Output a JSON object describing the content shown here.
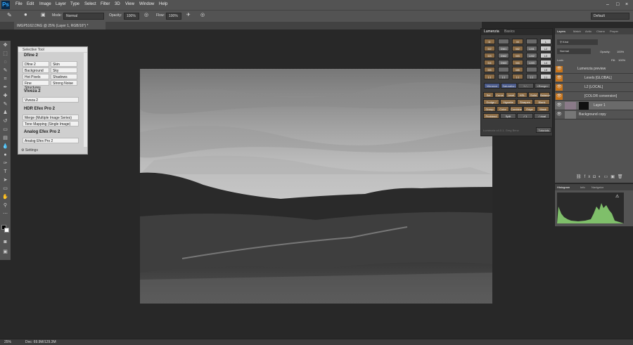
{
  "menubar": {
    "app_icon": "Ps",
    "items": [
      "File",
      "Edit",
      "Image",
      "Layer",
      "Type",
      "Select",
      "Filter",
      "3D",
      "View",
      "Window",
      "Help"
    ]
  },
  "options": {
    "mode_label": "Mode:",
    "mode_value": "Normal",
    "opacity_label": "Opacity:",
    "opacity_value": "100%",
    "flow_label": "Flow:",
    "flow_value": "100%",
    "workspace": "Default"
  },
  "document": {
    "tab_title": "IMGP5162.DNG @ 25% (Layer 1, RGB/16*) *"
  },
  "status": {
    "zoom": "25%",
    "doc": "Doc: 69.9M/129.3M"
  },
  "selective": {
    "title": "Selective Tool",
    "dfine_header": "Dfine 2",
    "dfine_cells": [
      "Dfine 2",
      "Skin",
      "Background",
      "Sky",
      "Hot Pixels",
      "Shadows",
      "Fine Structures",
      "Strong Noise"
    ],
    "viveza_header": "Viveza 2",
    "viveza_item": "Viveza 2",
    "hdr_header": "HDR Efex Pro 2",
    "hdr_items": [
      "Merge (Multiple Image Series)",
      "Tone Mapping (Single Image)"
    ],
    "analog_header": "Analog Efex Pro 2",
    "analog_item": "Analog Efex Pro 2",
    "settings": "Settings"
  },
  "lumenzia": {
    "tabs": [
      "Lumenzia",
      "Basics"
    ],
    "grid_left": [
      "D",
      "D2",
      "D3",
      "D4",
      "D5",
      "(-)"
    ],
    "grid_mid1": [
      "",
      "DM1",
      "DM2",
      "DM3",
      "",
      "(-)"
    ],
    "grid_mid2": [
      "M",
      "M2",
      "M3",
      "M4",
      "M5",
      "(-)"
    ],
    "grid_mid3": [
      "",
      "LM1",
      "LM2",
      "LM3",
      "",
      "(-)"
    ],
    "grid_right": [
      "L",
      "L2",
      "L3",
      "L4",
      "L5",
      "(-)"
    ],
    "row_wb": [
      "Vibrance",
      "Saturation",
      "+ / -",
      "<Range>"
    ],
    "buttons": [
      [
        "Sel",
        "Curve",
        "Level",
        "HSL",
        "Solid",
        "Balance"
      ],
      [
        "Dodge / Burn",
        "Vignette",
        "Sharpen",
        "Blank"
      ],
      [
        "Group",
        "Color",
        "Combine",
        "Edge",
        "Mask"
      ],
      [
        "Preblend",
        "Split",
        "✓1",
        "✓dual"
      ]
    ],
    "footer": "Lumenzia v4.0.1, Greg Benz",
    "tutorials": "Tutorials"
  },
  "layers": {
    "tabs": [
      "Layers",
      "Match",
      "Actio",
      "Chann",
      "Proper"
    ],
    "kind": "Kind",
    "blend": "Normal",
    "opacity_label": "Opacity:",
    "opacity_value": "100%",
    "lock_label": "Lock:",
    "fill_label": "Fill:",
    "fill_value": "100%",
    "items": [
      "Lumenzia preview",
      "Levels [GLOBAL]",
      "L2 [LOCAL]",
      "[COLOR conversion]",
      "Layer 1",
      "Background copy"
    ]
  },
  "histogram": {
    "tabs": [
      "Histogram",
      "Info",
      "Navigator"
    ]
  },
  "colors": {
    "panel": "#535353",
    "dark": "#282828",
    "orange": "#c8741a",
    "lum_btn": "#8a6b45"
  }
}
